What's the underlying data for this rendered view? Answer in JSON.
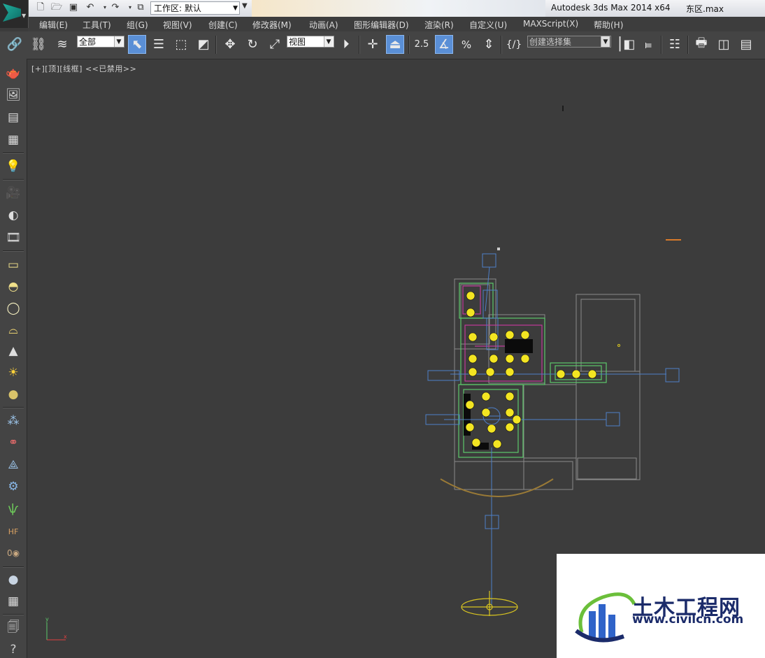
{
  "title": {
    "app": "Autodesk 3ds Max  2014 x64",
    "file": "东区.max",
    "workspace_label": "工作区: 默认"
  },
  "menu": [
    "编辑(E)",
    "工具(T)",
    "组(G)",
    "视图(V)",
    "创建(C)",
    "修改器(M)",
    "动画(A)",
    "图形编辑器(D)",
    "渲染(R)",
    "自定义(U)",
    "MAXScript(X)",
    "帮助(H)"
  ],
  "toolbar": {
    "selection_filter": "全部",
    "reference_coord": "视图",
    "snap_angle_label": "2.5",
    "named_selection_placeholder": "创建选择集"
  },
  "viewport": {
    "label": "[+][顶][线框] <<已禁用>>"
  },
  "watermark": {
    "cn": "土木工程网",
    "url": "www.civilcn.com"
  },
  "icons": {
    "quick_access": [
      "new-file-icon",
      "open-file-icon",
      "save-icon",
      "undo-icon",
      "redo-icon",
      "project-folder-icon"
    ],
    "left_toolbar": [
      "teapot-icon",
      "render-setup-icon",
      "material-editor-icon",
      "schematic-icon",
      "light-lister-icon",
      "camera-icon",
      "sky-icon",
      "render-frame-icon",
      "plane-icon",
      "dome-icon",
      "sphere-icon",
      "geosphere-icon",
      "cone-icon",
      "sun-icon",
      "sphere-light-icon",
      "scatter-icon",
      "particle-icon",
      "pyramid-icon",
      "gear-icon",
      "grass-icon",
      "hair-fur-icon",
      "zero-icon",
      "material-ball-icon",
      "calculator-icon",
      "batch-icon",
      "help-icon"
    ]
  },
  "colors": {
    "viewport_bg": "#3c3c3c",
    "wire_grey": "#8a8a8a",
    "wire_blue": "#4e7fc7",
    "light_yellow": "#f3e522",
    "wire_green": "#5cc86a",
    "wire_magenta": "#c0399a"
  }
}
